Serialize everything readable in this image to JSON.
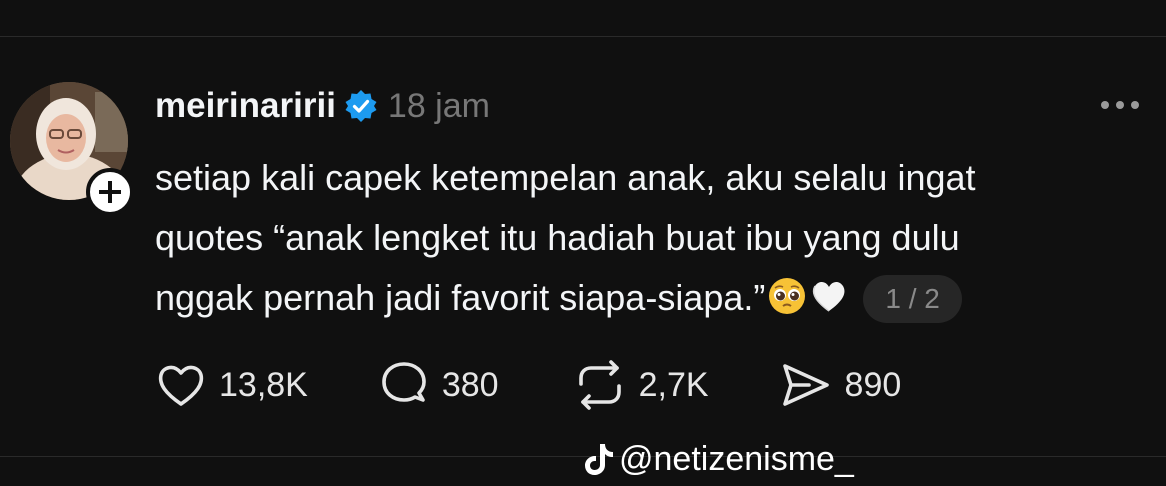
{
  "post": {
    "username": "meirinaririi",
    "timestamp": "18 jam",
    "text_lines": [
      "setiap kali capek ketempelan anak, aku selalu ingat",
      "quotes “anak lengket itu hadiah buat ibu yang dulu",
      "nggak pernah jadi favorit siapa-siapa.”"
    ],
    "emojis": [
      "pleading-face",
      "white-heart"
    ],
    "page_indicator": "1 / 2"
  },
  "actions": {
    "likes": "13,8K",
    "replies": "380",
    "reposts": "2,7K",
    "shares": "890"
  },
  "watermark": {
    "handle": "@netizenisme_",
    "icon": "tiktok-icon"
  },
  "colors": {
    "background": "#101010",
    "text": "#f3f5f7",
    "muted": "#777777",
    "verified": "#1d9bf0"
  }
}
